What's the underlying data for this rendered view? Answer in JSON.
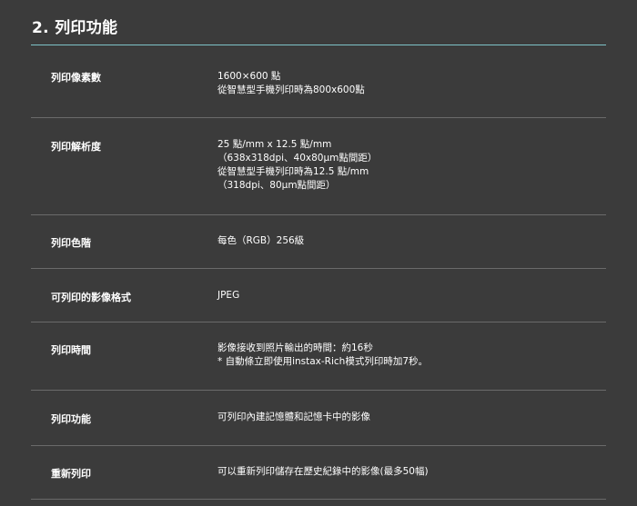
{
  "section": {
    "title": "2. 列印功能"
  },
  "specs": [
    {
      "label": "列印像素數",
      "lines": [
        "1600×600 點",
        "從智慧型手機列印時為800x600點"
      ]
    },
    {
      "label": "列印解析度",
      "lines": [
        "25 點/mm x 12.5 點/mm",
        "（638x318dpi、40x80μm點間距）",
        "從智慧型手機列印時為12.5 點/mm",
        "（318dpi、80μm點間距）"
      ]
    },
    {
      "label": "列印色階",
      "lines": [
        "每色（RGB）256級"
      ]
    },
    {
      "label": "可列印的影像格式",
      "lines": [
        "JPEG"
      ]
    },
    {
      "label": "列印時間",
      "lines": [
        "影像接收到照片輸出的時間：約16秒",
        "* 自動條立即使用instax-Rich模式列印時加7秒。"
      ]
    },
    {
      "label": "列印功能",
      "lines": [
        "可列印內建記憶體和記憶卡中的影像"
      ]
    },
    {
      "label": "重新列印",
      "lines": [
        "可以重新列印儲存在歷史紀錄中的影像(最多50幅)"
      ]
    }
  ]
}
